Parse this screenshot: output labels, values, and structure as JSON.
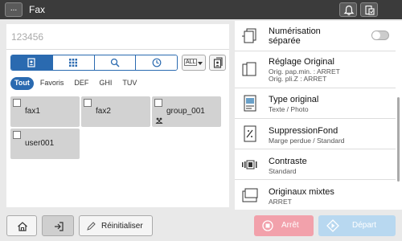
{
  "topbar": {
    "menu_label": "...",
    "title": "Fax",
    "icons": [
      "bell-icon",
      "job-status-icon"
    ]
  },
  "destination": {
    "number_value": "123456"
  },
  "search_tabs": [
    {
      "name": "address-book-icon",
      "active": true
    },
    {
      "name": "keypad-icon",
      "active": false
    },
    {
      "name": "search-icon",
      "active": false
    },
    {
      "name": "history-icon",
      "active": false
    }
  ],
  "filter": {
    "all_label": "ALL"
  },
  "index_tabs": [
    {
      "label": "Tout",
      "active": true
    },
    {
      "label": "Favoris",
      "active": false
    },
    {
      "label": "DEF",
      "active": false
    },
    {
      "label": "GHI",
      "active": false
    },
    {
      "label": "TUV",
      "active": false
    }
  ],
  "destinations": [
    {
      "label": "fax1",
      "group": false
    },
    {
      "label": "fax2",
      "group": false
    },
    {
      "label": "group_001",
      "group": true
    },
    {
      "label": "user001",
      "group": false
    }
  ],
  "settings": [
    {
      "title": "Numérisation\nséparée",
      "sub": "",
      "icon": "separate-scan-icon",
      "toggle": false
    },
    {
      "title": "Réglage Original",
      "sub": "Orig. pap.min. : ARRET\nOrig. pli.Z : ARRET",
      "icon": "original-setting-icon"
    },
    {
      "title": "Type original",
      "sub": "Texte / Photo",
      "icon": "original-type-icon"
    },
    {
      "title": "SuppressionFond",
      "sub": "Marge perdue / Standard",
      "icon": "background-removal-icon"
    },
    {
      "title": "Contraste",
      "sub": "Standard",
      "icon": "contrast-icon"
    },
    {
      "title": "Originaux mixtes",
      "sub": "ARRET",
      "icon": "mixed-originals-icon"
    }
  ],
  "bottom": {
    "reset_label": "Réinitialiser",
    "stop_label": "Arrêt",
    "start_label": "Départ"
  },
  "colors": {
    "accent": "#2a6ab0",
    "stop": "#f2a1ab",
    "start": "#b8d8f0"
  }
}
